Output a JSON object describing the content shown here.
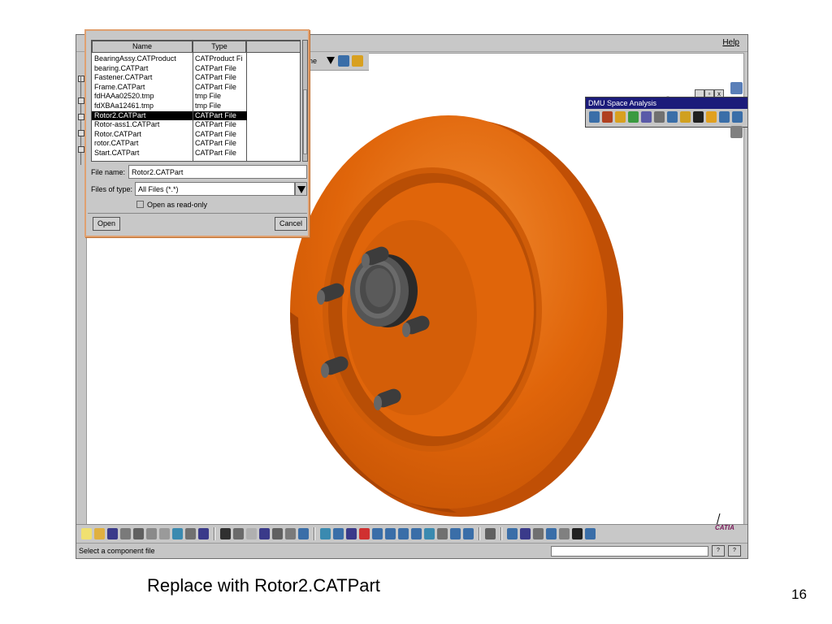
{
  "app": {
    "help_menu": "Help",
    "option_text": "ne",
    "window_controls": [
      "_",
      "▫",
      "x"
    ],
    "status_text": "Select a component file",
    "status_buttons": [
      "?",
      "?"
    ]
  },
  "dmu_toolbar": {
    "title": "DMU Space Analysis",
    "icon_colors": [
      "#3a6ea8",
      "#b04020",
      "#d8a020",
      "#3a9a40",
      "#5a5aa8",
      "#707070",
      "#3a6ea8",
      "#d0a020",
      "#202020",
      "#e0a020",
      "#3a6ea8",
      "#3a6ea8"
    ]
  },
  "bottom_toolbar": {
    "group1_colors": [
      "#f0e070",
      "#e0b040",
      "#3a3a8a",
      "#7a7a7a",
      "#606060",
      "#8a8a8a",
      "#9a9a9a",
      "#3a8ab0",
      "#707070",
      "#3a3a8a"
    ],
    "group2_colors": [
      "#303030",
      "#6a6a6a",
      "#b0b0b0",
      "#3a3a8a",
      "#606060",
      "#7a7a7a",
      "#3a6ea8"
    ],
    "group3_colors": [
      "#3a8ab0",
      "#3a6ea8",
      "#3a3a8a",
      "#d03030",
      "#3a6ea8",
      "#3a6ea8",
      "#3a6ea8",
      "#3a6ea8",
      "#3a8ab0",
      "#707070",
      "#3a6ea8",
      "#3a6ea8"
    ],
    "group4_colors": [
      "#606060"
    ],
    "group5_colors": [
      "#3a6ea8",
      "#3a3a8a",
      "#707070",
      "#3a6ea8",
      "#808080",
      "#202020",
      "#3a6ea8"
    ],
    "logo_text": "CATIA"
  },
  "file_dialog": {
    "column_name": "Name",
    "column_type": "Type",
    "files": [
      {
        "name": "BearingAssy.CATProduct",
        "type": "CATProduct Fi",
        "selected": false
      },
      {
        "name": "bearing.CATPart",
        "type": "CATPart File",
        "selected": false
      },
      {
        "name": "Fastener.CATPart",
        "type": "CATPart File",
        "selected": false
      },
      {
        "name": "Frame.CATPart",
        "type": "CATPart File",
        "selected": false
      },
      {
        "name": "fdHAAa02520.tmp",
        "type": "tmp File",
        "selected": false
      },
      {
        "name": "fdXBAa12461.tmp",
        "type": "tmp File",
        "selected": false
      },
      {
        "name": "Rotor2.CATPart",
        "type": "CATPart File",
        "selected": true
      },
      {
        "name": "Rotor-ass1.CATPart",
        "type": "CATPart File",
        "selected": false
      },
      {
        "name": "Rotor.CATPart",
        "type": "CATPart File",
        "selected": false
      },
      {
        "name": "rotor.CATPart",
        "type": "CATPart File",
        "selected": false
      },
      {
        "name": "Start.CATPart",
        "type": "CATPart File",
        "selected": false
      }
    ],
    "file_name_label": "File name:",
    "file_name_value": "Rotor2.CATPart",
    "files_of_type_label": "Files of type:",
    "files_of_type_value": "All Files (*.*)",
    "read_only_label": "Open as read-only",
    "open_button": "Open",
    "cancel_button": "Cancel"
  },
  "slide": {
    "caption": "Replace with Rotor2.CATPart",
    "page_number": "16"
  },
  "colors": {
    "pulley": "#e0650a",
    "pulley_dark": "#b84e05",
    "bolt": "#3c3c3c",
    "dialog_border": "#e0a070",
    "dmu_title_bg": "#1b1b7a"
  }
}
